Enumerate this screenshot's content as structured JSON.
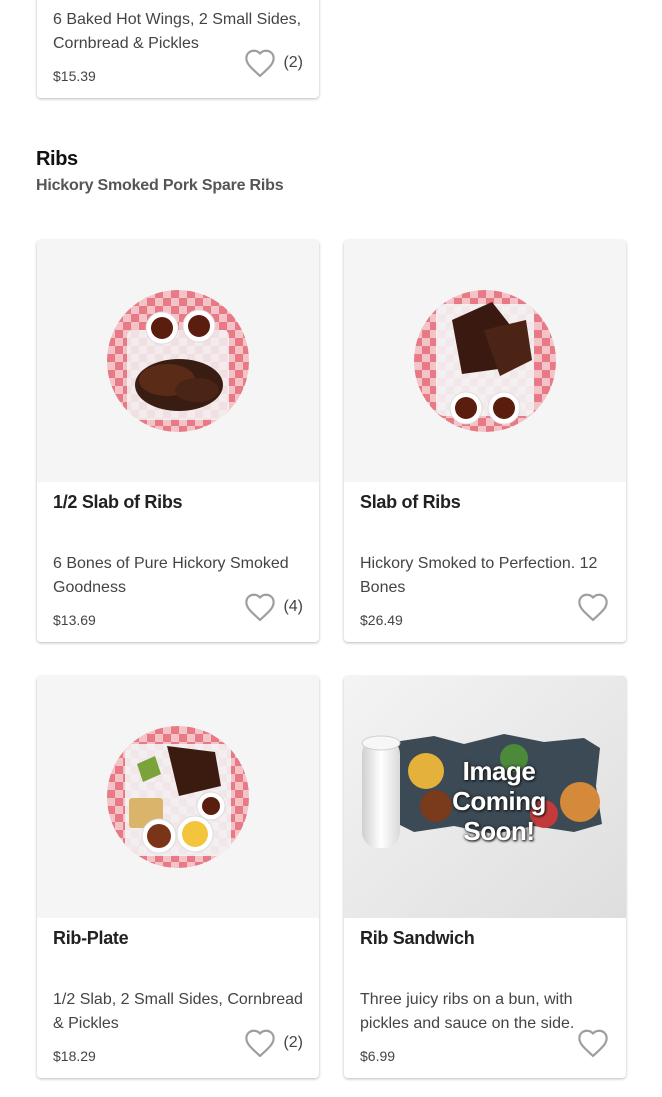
{
  "section": {
    "title": "Ribs",
    "subtitle": "Hickory Smoked Pork Spare Ribs"
  },
  "colors": {
    "checker_red": "#e35a6a",
    "heart_outline": "#9e9e9e",
    "card_bg": "#f5f5f5"
  },
  "items": [
    {
      "description": "6 Baked Hot Wings, 2 Small Sides, Cornbread & Pickles",
      "price": "$15.39",
      "favorite_count": "(2)",
      "icon": "heart-outline-icon"
    },
    {
      "name": "1/2 Slab of Ribs",
      "description": "6 Bones of Pure Hickory Smoked Goodness",
      "price": "$13.69",
      "favorite_count": "(4)",
      "icon": "heart-outline-icon"
    },
    {
      "name": "Slab of Ribs",
      "description": "Hickory Smoked to Perfection. 12 Bones",
      "price": "$26.49",
      "icon": "heart-outline-icon"
    },
    {
      "name": "Rib-Plate",
      "description": "1/2 Slab, 2 Small Sides, Cornbread & Pickles",
      "price": "$18.29",
      "favorite_count": "(2)",
      "icon": "heart-outline-icon"
    },
    {
      "name": "Rib Sandwich",
      "description": "Three juicy ribs on a bun, with pickles and sauce on the side.",
      "price": "$6.99",
      "placeholder_text": "Image Coming Soon!",
      "icon": "heart-outline-icon"
    }
  ]
}
